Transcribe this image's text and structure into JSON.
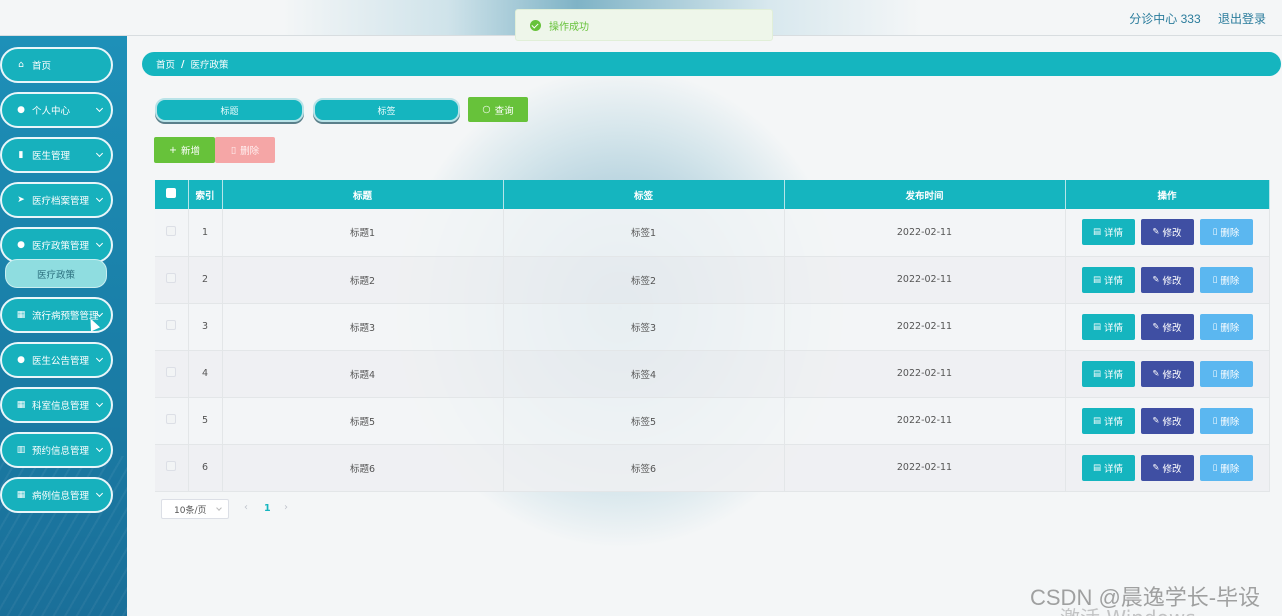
{
  "header": {
    "user_role": "分诊中心 333",
    "logout": "退出登录"
  },
  "toast": {
    "message": "操作成功"
  },
  "sidebar": {
    "items": [
      {
        "label": "首页",
        "icon": "home-icon"
      },
      {
        "label": "个人中心",
        "icon": "user-icon"
      },
      {
        "label": "医生管理",
        "icon": "clipboard-icon"
      },
      {
        "label": "医疗档案管理",
        "icon": "send-icon"
      },
      {
        "label": "医疗政策管理",
        "icon": "location-icon"
      },
      {
        "label": "流行病预警管理",
        "icon": "grid-icon"
      },
      {
        "label": "医生公告管理",
        "icon": "user-icon"
      },
      {
        "label": "科室信息管理",
        "icon": "grid-icon"
      },
      {
        "label": "预约信息管理",
        "icon": "chart-icon"
      },
      {
        "label": "病例信息管理",
        "icon": "grid-icon"
      }
    ],
    "submenu": {
      "label": "医疗政策"
    }
  },
  "breadcrumb": {
    "home": "首页",
    "separator": "/",
    "current": "医疗政策"
  },
  "search": {
    "title_placeholder": "标题",
    "tag_placeholder": "标签",
    "query_label": "查询"
  },
  "toolbar": {
    "add_label": "新增",
    "delete_label": "删除"
  },
  "table": {
    "headers": [
      "索引",
      "标题",
      "标签",
      "发布时间",
      "操作"
    ],
    "rows": [
      {
        "index": "1",
        "title": "标题1",
        "tag": "标签1",
        "date": "2022-02-11"
      },
      {
        "index": "2",
        "title": "标题2",
        "tag": "标签2",
        "date": "2022-02-11"
      },
      {
        "index": "3",
        "title": "标题3",
        "tag": "标签3",
        "date": "2022-02-11"
      },
      {
        "index": "4",
        "title": "标题4",
        "tag": "标签4",
        "date": "2022-02-11"
      },
      {
        "index": "5",
        "title": "标题5",
        "tag": "标签5",
        "date": "2022-02-11"
      },
      {
        "index": "6",
        "title": "标题6",
        "tag": "标签6",
        "date": "2022-02-11"
      }
    ],
    "actions": {
      "detail": "详情",
      "edit": "修改",
      "delete": "删除"
    }
  },
  "pagination": {
    "page_size": "10条/页",
    "current_page": "1",
    "prev": "‹",
    "next": "›"
  },
  "watermark": {
    "text": "CSDN @晨逸学长-毕设",
    "text2": "激活 Windows"
  },
  "colors": {
    "accent": "#15b5bf",
    "sidebar": "#1e90b8",
    "success": "#67c23a",
    "edit": "#3f4fa3",
    "delete": "#5bb7f0"
  }
}
